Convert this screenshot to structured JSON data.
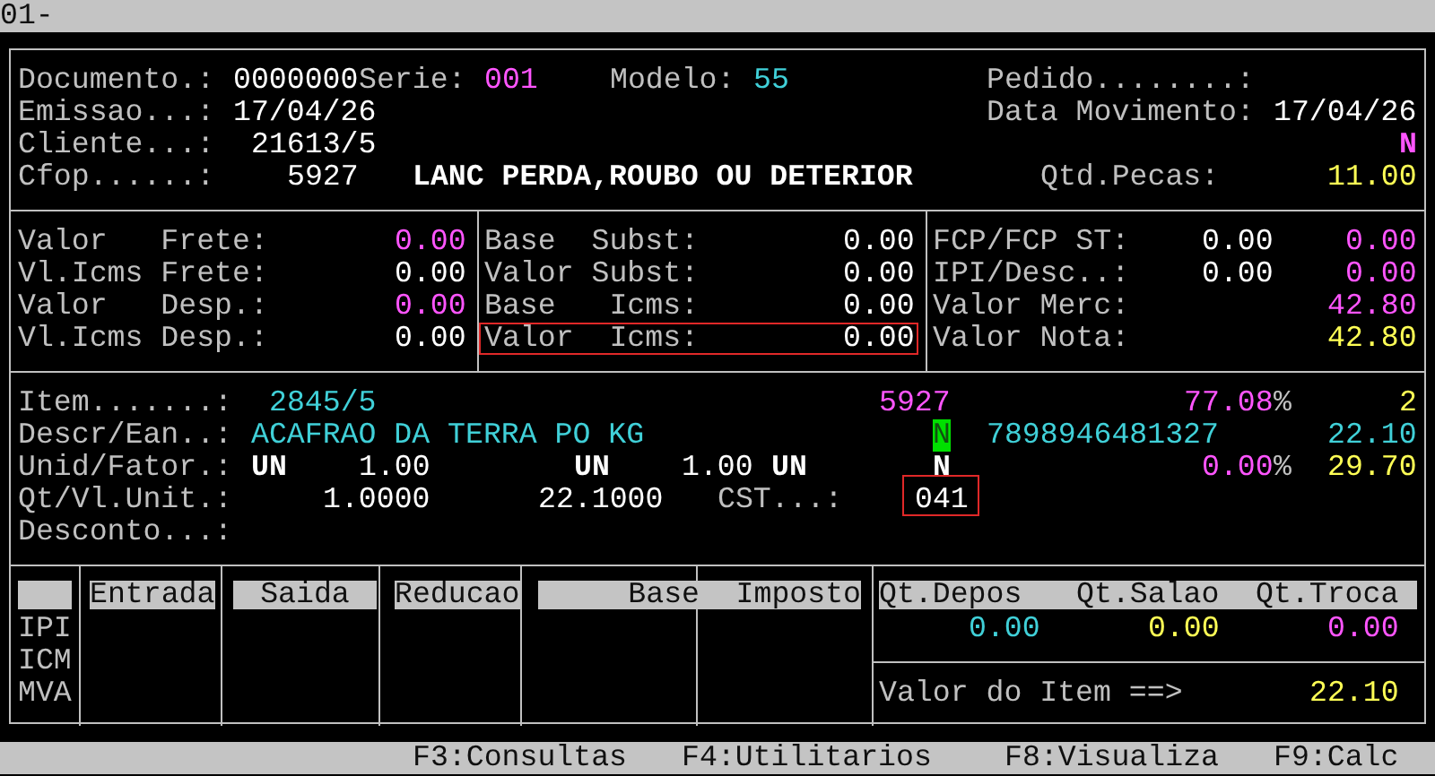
{
  "title_bar": {
    "text": "01-"
  },
  "header": {
    "documento": {
      "label": "Documento.:",
      "value": "0000000"
    },
    "serie": {
      "label": "Serie:",
      "value": "001",
      "color": "#ff55ff"
    },
    "modelo": {
      "label": "Modelo:",
      "value": "55",
      "color": "#40d0d8"
    },
    "pedido": {
      "label": "Pedido........:"
    },
    "emissao": {
      "label": "Emissao...:",
      "value": "17/04/26"
    },
    "data_movimento": {
      "label": "Data Movimento:",
      "value": "17/04/26"
    },
    "cliente": {
      "label": "Cliente...:",
      "value": "21613/5"
    },
    "status_flag": {
      "text": "N",
      "color": "#ff55ff"
    },
    "cfop": {
      "label": "Cfop......:",
      "code": "5927",
      "description": "LANC PERDA,ROUBO OU DETERIOR"
    },
    "qtd_pecas": {
      "label": "Qtd.Pecas:",
      "value": "11.00",
      "color": "#ffff55"
    }
  },
  "freight": [
    {
      "label": "Valor   Frete:",
      "value": "0.00",
      "color": "#ff55ff"
    },
    {
      "label": "Vl.Icms Frete:",
      "value": "0.00",
      "color": "#ffffff"
    },
    {
      "label": "Valor   Desp.:",
      "value": "0.00",
      "color": "#ff55ff"
    },
    {
      "label": "Vl.Icms Desp.:",
      "value": "0.00",
      "color": "#ffffff"
    }
  ],
  "substitution": [
    {
      "label": "Base  Subst:",
      "value": "0.00",
      "flagged": false
    },
    {
      "label": "Valor Subst:",
      "value": "0.00",
      "flagged": false
    },
    {
      "label": "Base   Icms:",
      "value": "0.00",
      "flagged": false
    },
    {
      "label": "Valor  Icms:",
      "value": "0.00",
      "flagged": true
    }
  ],
  "summary": [
    {
      "label": "FCP/FCP ST:",
      "values": [
        {
          "text": "0.00",
          "color": "#ffffff"
        },
        {
          "text": "0.00",
          "color": "#ff55ff"
        }
      ]
    },
    {
      "label": "IPI/Desc..:",
      "values": [
        {
          "text": "0.00",
          "color": "#ffffff"
        },
        {
          "text": "0.00",
          "color": "#ff55ff"
        }
      ]
    },
    {
      "label": "Valor Merc:",
      "values": [
        {
          "text": "42.80",
          "color": "#ff55ff"
        }
      ]
    },
    {
      "label": "Valor Nota:",
      "values": [
        {
          "text": "42.80",
          "color": "#ffff55"
        }
      ]
    }
  ],
  "item": {
    "item": {
      "label": "Item.......:",
      "code": "2845/5",
      "cfop": "5927",
      "percent": {
        "value": "77.08",
        "unit": "%"
      },
      "count": "2"
    },
    "descr": {
      "label": "Descr/Ean..:",
      "description": "ACAFRAO DA TERRA PO KG",
      "flag": {
        "text": "N",
        "highlighted": true
      },
      "ean": "7898946481327",
      "price": "22.10"
    },
    "unid": {
      "label": "Unid/Fator.:",
      "units": [
        {
          "unit": "UN",
          "factor": "1.00"
        },
        {
          "unit": "UN",
          "factor": "1.00"
        },
        {
          "unit": "UN"
        }
      ],
      "flag": {
        "text": "N",
        "highlighted": false
      },
      "percent": {
        "value": "0.00",
        "unit": "%"
      },
      "value": "29.70"
    },
    "qt": {
      "label": "Qt/Vl.Unit.:",
      "quantity": "1.0000",
      "unit_value": "22.1000",
      "cst": {
        "label": "CST...:",
        "value": "041",
        "flagged": true
      }
    },
    "desconto": {
      "label": "Desconto...:"
    }
  },
  "tax_table": {
    "columns": [
      "Entrada",
      "Saida",
      "Reducao",
      "Base",
      "Imposto"
    ],
    "row_labels": [
      "IPI",
      "ICM",
      "MVA"
    ]
  },
  "stock": {
    "columns": [
      "Qt.Depos",
      "Qt.Salao",
      "Qt.Troca"
    ],
    "values": [
      {
        "text": "0.00",
        "color": "#40d0d8"
      },
      {
        "text": "0.00",
        "color": "#ffff55"
      },
      {
        "text": "0.00",
        "color": "#ff55ff"
      }
    ]
  },
  "item_total": {
    "label": "Valor do Item ==>",
    "value": "22.10",
    "color": "#ffff55"
  },
  "function_keys": [
    "F3:Consultas",
    "F4:Utilitarios",
    "F8:Visualiza",
    "F9:Calc"
  ]
}
